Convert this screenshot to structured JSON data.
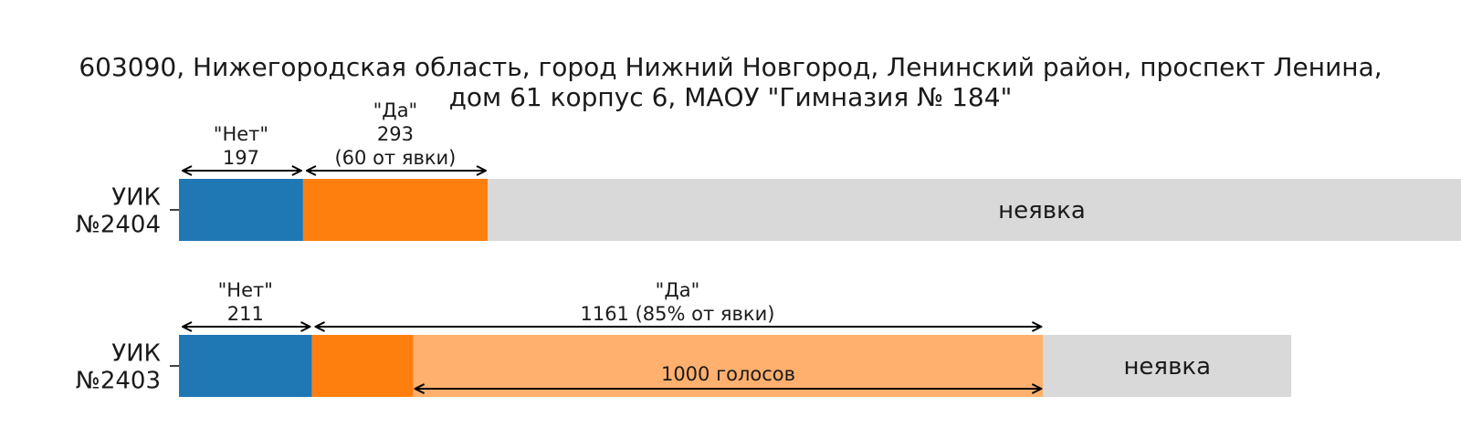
{
  "chart_data": {
    "type": "bar",
    "orientation": "horizontal",
    "stacked": true,
    "title_lines": [
      "603090, Нижегородская область, город Нижний Новгород, Ленинский район, проспект Ленина,",
      "дом 61 корпус 6, МАОУ \"Гимназия  № 184\""
    ],
    "grid": false,
    "categories": [
      {
        "label_lines": [
          "УИК",
          "№2404"
        ],
        "segments": [
          {
            "key": "net",
            "value": 197,
            "color": "#1f77b4"
          },
          {
            "key": "da",
            "value": 293,
            "color": "#ff7f0e"
          },
          {
            "key": "neyavka",
            "value": 1760,
            "color": "#d9d9d9",
            "label": "неявка"
          }
        ],
        "annotations": [
          {
            "from": 0,
            "to": 197,
            "lines": [
              "\"Нет\"",
              "197"
            ]
          },
          {
            "from": 197,
            "to": 490,
            "lines": [
              "\"Да\"",
              "293",
              "(60 от явки)"
            ]
          }
        ]
      },
      {
        "label_lines": [
          "УИК",
          "№2403"
        ],
        "segments": [
          {
            "key": "net",
            "value": 211,
            "color": "#1f77b4"
          },
          {
            "key": "da",
            "value": 161,
            "color": "#ff7f0e"
          },
          {
            "key": "da_extra",
            "value": 1000,
            "color": "#ffb06e",
            "inner_arrow": "1000 голосов"
          },
          {
            "key": "neyavka",
            "value": 394,
            "color": "#d9d9d9",
            "label": "неявка"
          }
        ],
        "annotations": [
          {
            "from": 0,
            "to": 211,
            "lines": [
              "\"Нет\"",
              "211"
            ]
          },
          {
            "from": 211,
            "to": 1372,
            "lines": [
              "\"Да\"",
              "1161 (85% от явки)"
            ]
          }
        ]
      }
    ],
    "xlim": [
      0,
      1760
    ]
  }
}
